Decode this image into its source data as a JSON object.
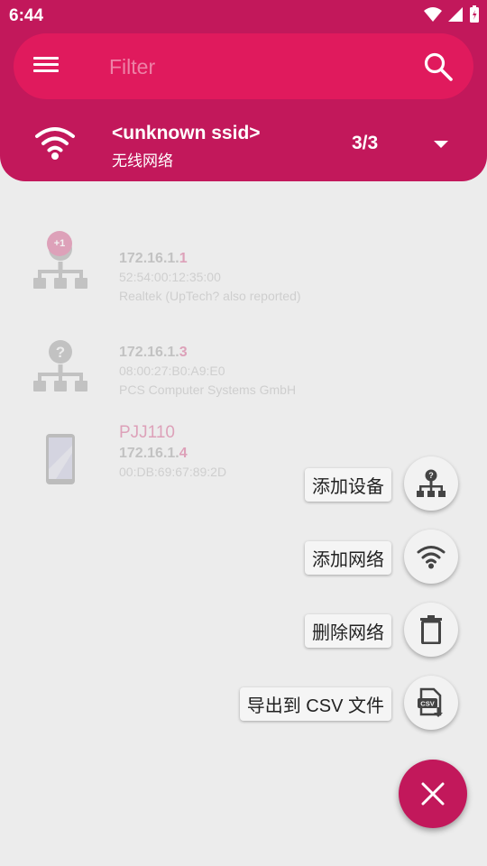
{
  "status_bar": {
    "time": "6:44"
  },
  "search": {
    "placeholder": "Filter",
    "value": ""
  },
  "network": {
    "ssid": "<unknown ssid>",
    "type": "无线网络",
    "count": "3/3"
  },
  "devices": [
    {
      "ip_prefix": "172.16.1.",
      "ip_last": "1",
      "mac": "52:54:00:12:35:00",
      "vendor": "Realtek (UpTech? also reported)",
      "badge": "+1",
      "icon": "network-unknown-icon"
    },
    {
      "ip_prefix": "172.16.1.",
      "ip_last": "3",
      "mac": "08:00:27:B0:A9:E0",
      "vendor": "PCS Computer Systems GmbH",
      "icon": "network-unknown-icon"
    },
    {
      "name": "PJJ110",
      "ip_prefix": "172.16.1.",
      "ip_last": "4",
      "mac": "00:DB:69:67:89:2D",
      "icon": "phone-icon"
    }
  ],
  "fab_menu": {
    "add_device": "添加设备",
    "add_network": "添加网络",
    "delete_network": "删除网络",
    "export_csv": "导出到 CSV 文件"
  },
  "colors": {
    "primary": "#c2185b",
    "search_bar": "#e01a5d",
    "background": "#ececec"
  }
}
